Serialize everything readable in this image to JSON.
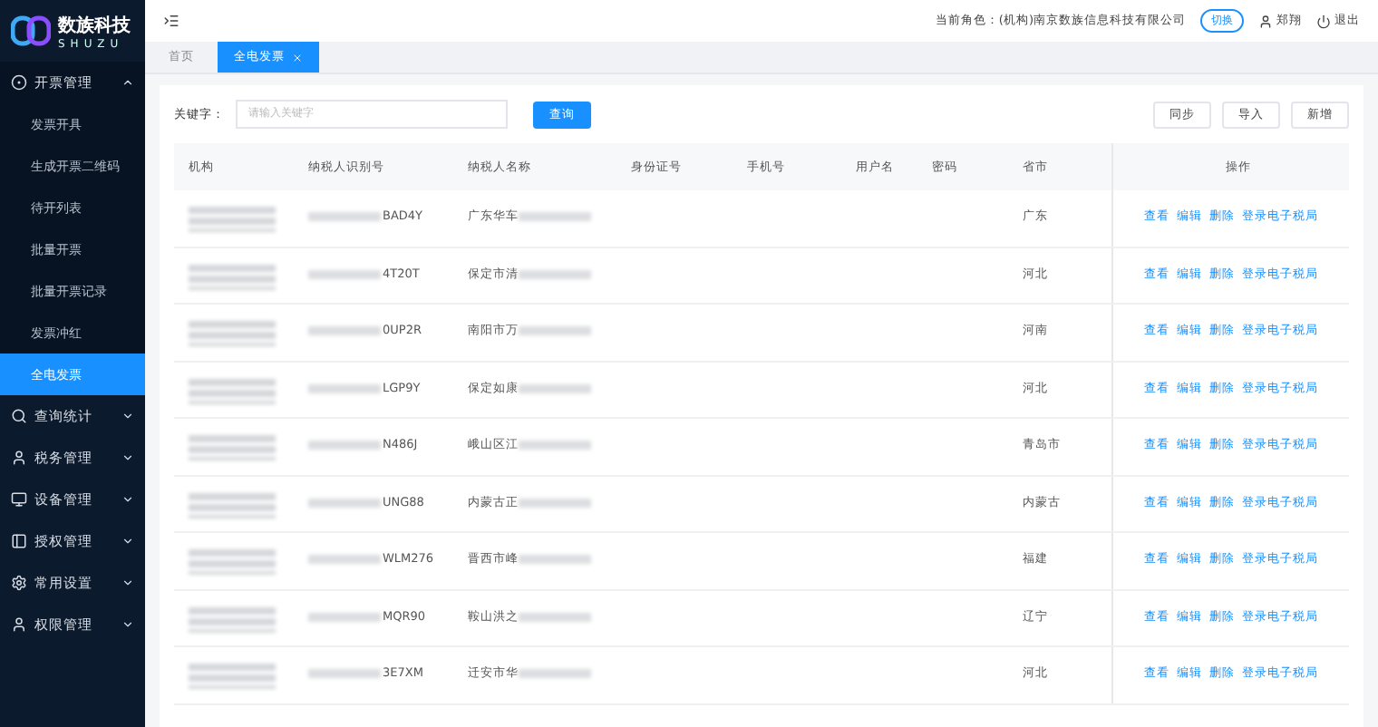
{
  "logo": {
    "name": "数族科技",
    "sub": "SHUZU"
  },
  "sidebar": {
    "items": [
      {
        "label": "开票管理",
        "expanded": true,
        "children": [
          {
            "label": "发票开具",
            "selected": false
          },
          {
            "label": "生成开票二维码",
            "selected": false
          },
          {
            "label": "待开列表",
            "selected": false
          },
          {
            "label": "批量开票",
            "selected": false
          },
          {
            "label": "批量开票记录",
            "selected": false
          },
          {
            "label": "发票冲红",
            "selected": false
          },
          {
            "label": "全电发票",
            "selected": true
          }
        ]
      },
      {
        "label": "查询统计",
        "expanded": false
      },
      {
        "label": "税务管理",
        "expanded": false
      },
      {
        "label": "设备管理",
        "expanded": false
      },
      {
        "label": "授权管理",
        "expanded": false
      },
      {
        "label": "常用设置",
        "expanded": false
      },
      {
        "label": "权限管理",
        "expanded": false
      }
    ]
  },
  "header": {
    "role_label": "当前角色：",
    "role": "(机构)南京数族信息科技有限公司",
    "switch": "切换",
    "user": "郑翔",
    "logout": "退出"
  },
  "tabs": [
    {
      "label": "首页",
      "selected": false,
      "closable": false
    },
    {
      "label": "全电发票",
      "selected": true,
      "closable": true
    }
  ],
  "search": {
    "label": "关键字：",
    "placeholder": "请输入关键字",
    "button": "查询"
  },
  "actions": [
    "同步",
    "导入",
    "新增"
  ],
  "table": {
    "columns": [
      "机构",
      "纳税人识别号",
      "纳税人名称",
      "身份证号",
      "手机号",
      "用户名",
      "密码",
      "省市",
      "操作"
    ],
    "rows": [
      {
        "tax_id": "BAD4Y",
        "name": "广东华车",
        "province": "广东",
        "actions": [
          "查看",
          "编辑",
          "删除",
          "登录电子税局"
        ]
      },
      {
        "tax_id": "4T20T",
        "name": "保定市清",
        "province": "河北",
        "actions": [
          "查看",
          "编辑",
          "删除",
          "登录电子税局"
        ]
      },
      {
        "tax_id": "0UP2R",
        "name": "南阳市万",
        "province": "河南",
        "actions": [
          "查看",
          "编辑",
          "删除",
          "登录电子税局"
        ]
      },
      {
        "tax_id": "LGP9Y",
        "name": "保定如康",
        "province": "河北",
        "actions": [
          "查看",
          "编辑",
          "删除",
          "登录电子税局"
        ]
      },
      {
        "tax_id": "N486J",
        "name": "峨山区江",
        "province": "青岛市",
        "actions": [
          "查看",
          "编辑",
          "删除",
          "登录电子税局"
        ]
      },
      {
        "tax_id": "UNG88",
        "name": "内蒙古正",
        "province": "内蒙古",
        "actions": [
          "查看",
          "编辑",
          "删除",
          "登录电子税局"
        ]
      },
      {
        "tax_id": "WLM276",
        "name": "晋西市峰",
        "province": "福建",
        "actions": [
          "查看",
          "编辑",
          "删除",
          "登录电子税局"
        ]
      },
      {
        "tax_id": "MQR90",
        "name": "鞍山洪之",
        "province": "辽宁",
        "actions": [
          "查看",
          "编辑",
          "删除",
          "登录电子税局"
        ]
      },
      {
        "tax_id": "3E7XM",
        "name": "迁安市华",
        "province": "河北",
        "actions": [
          "查看",
          "编辑",
          "删除",
          "登录电子税局"
        ]
      }
    ]
  }
}
